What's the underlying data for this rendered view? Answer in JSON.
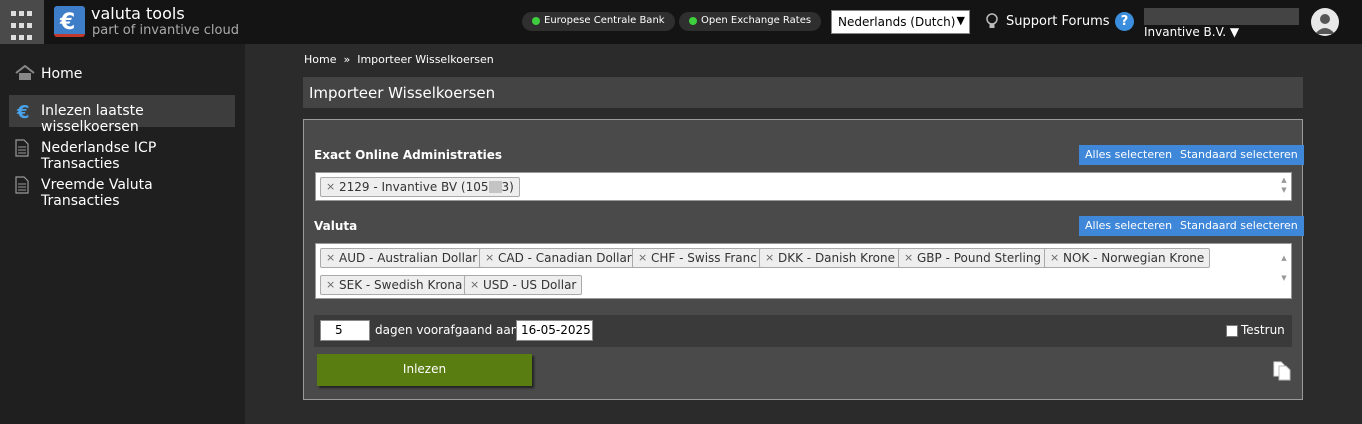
{
  "header": {
    "brand_title": "valuta tools",
    "brand_subtitle": "part of invantive cloud",
    "status_pills": [
      {
        "label": "Europese Centrale Bank",
        "status_color": "#3ecf3e"
      },
      {
        "label": "Open Exchange Rates",
        "status_color": "#3ecf3e"
      }
    ],
    "language_selected": "Nederlands (Dutch)",
    "support_label": "Support Forums",
    "help_label": "?",
    "company_label": "Invantive B.V. ▼"
  },
  "sidebar": {
    "items": [
      {
        "label": "Home",
        "icon": "home-icon"
      },
      {
        "label": "Inlezen laatste wisselkoersen",
        "icon": "euro-icon",
        "active": true
      },
      {
        "label": "Nederlandse ICP Transacties",
        "icon": "document-icon"
      },
      {
        "label": "Vreemde Valuta Transacties",
        "icon": "document-icon"
      }
    ]
  },
  "breadcrumb": {
    "home": "Home",
    "separator": "»",
    "current": "Importeer Wisselkoersen"
  },
  "page_title": "Importeer Wisselkoersen",
  "administrations": {
    "label": "Exact Online Administraties",
    "select_all": "Alles selecteren",
    "select_default": "Standaard selecteren",
    "tag_prefix": "2129 - Invantive BV (105",
    "tag_suffix": "3)"
  },
  "currencies": {
    "label": "Valuta",
    "select_all": "Alles selecteren",
    "select_default": "Standaard selecteren",
    "tags": [
      "AUD - Australian Dollar",
      "CAD - Canadian Dollar",
      "CHF - Swiss Franc",
      "DKK - Danish Krone",
      "GBP - Pound Sterling",
      "NOK - Norwegian Krone",
      "SEK - Swedish Krona",
      "USD - US Dollar"
    ]
  },
  "form": {
    "days_value": "5",
    "days_label": "dagen voorafgaand aan",
    "date_value": "16-05-2025",
    "testrun_label": "Testrun",
    "submit_label": "Inlezen"
  },
  "colors": {
    "accent": "#3f87d9",
    "submit": "#5a7d12",
    "status_ok": "#3ecf3e"
  }
}
